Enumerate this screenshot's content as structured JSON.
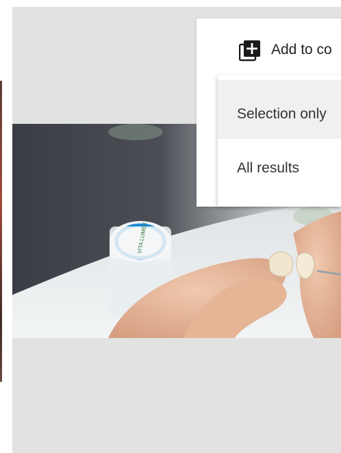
{
  "toolbar": {
    "add_label": "Add to co",
    "accent_color": "#e91e63"
  },
  "add_menu": {
    "items": [
      {
        "label": "Selection only"
      },
      {
        "label": "All results"
      }
    ]
  },
  "icons": {
    "add_collection": "add-to-collection-icon"
  },
  "photo": {
    "bottle_label": "VITA LUMEX"
  }
}
